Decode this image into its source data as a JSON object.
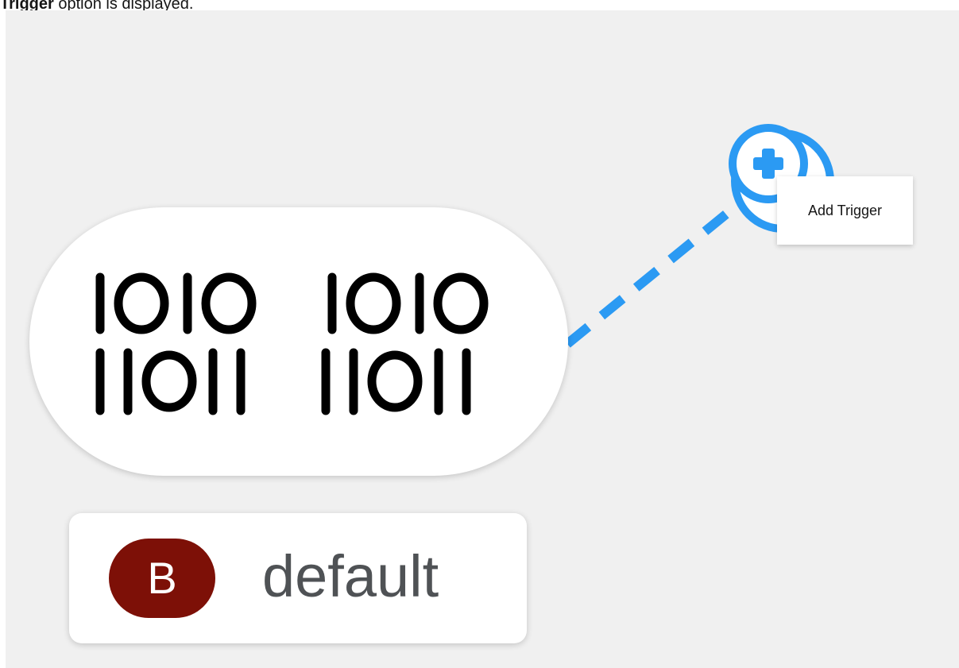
{
  "caption": {
    "bold": "Trigger",
    "rest": " option is displayed."
  },
  "binding_node": {
    "icon": "binary-icon",
    "binary_lines": [
      "1010 1010",
      "11011 11011"
    ]
  },
  "label": {
    "badge": "B",
    "badge_color": "#7d1007",
    "name": "default"
  },
  "add_trigger": {
    "icon": "plus-circle-icon",
    "accent": "#2b9af3",
    "tooltip": "Add Trigger"
  }
}
